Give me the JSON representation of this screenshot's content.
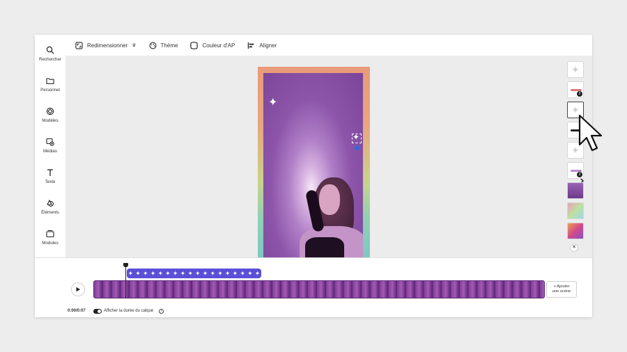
{
  "sidebar": {
    "items": [
      {
        "label": "Rechercher",
        "icon": "search-icon"
      },
      {
        "label": "Personnel",
        "icon": "folder-icon"
      },
      {
        "label": "Modèles",
        "icon": "templates-icon"
      },
      {
        "label": "Médias",
        "icon": "media-icon"
      },
      {
        "label": "Texte",
        "icon": "text-icon"
      },
      {
        "label": "Éléments",
        "icon": "elements-icon"
      },
      {
        "label": "Modules",
        "icon": "modules-icon"
      }
    ]
  },
  "toolbar": {
    "resize_label": "Redimensionner",
    "theme_label": "Thème",
    "bg_color_label": "Couleur d'AP",
    "align_label": "Aligner"
  },
  "canvas": {
    "accent_color": "#5a4fd6",
    "selection_handle_color": "#2f6bd9"
  },
  "scene_thumbnails": {
    "badges": [
      "2",
      "2"
    ]
  },
  "timeline": {
    "time": "0:00/0:07",
    "toggle_label": "Afficher la durée du calque",
    "add_scene_line1": "+ Ajouter",
    "add_scene_line2": "une scène",
    "layer_color": "#5a4fd6"
  }
}
